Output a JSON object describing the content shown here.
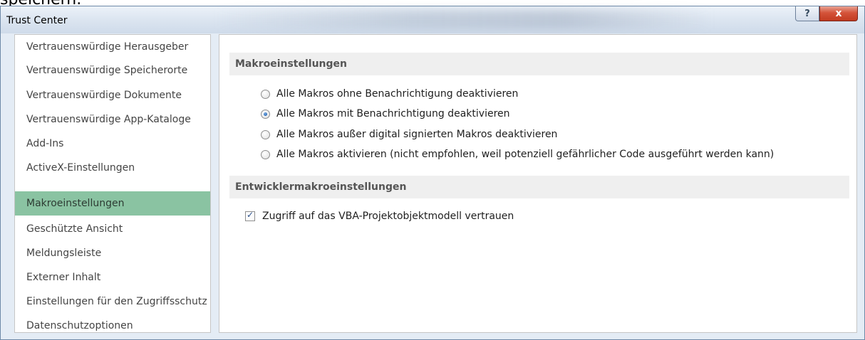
{
  "background_text": "speichern.",
  "window": {
    "title": "Trust Center",
    "help_label": "?",
    "close_label": "x"
  },
  "sidebar": {
    "items": [
      {
        "label": "Vertrauenswürdige Herausgeber",
        "selected": false
      },
      {
        "label": "Vertrauenswürdige Speicherorte",
        "selected": false
      },
      {
        "label": "Vertrauenswürdige Dokumente",
        "selected": false
      },
      {
        "label": "Vertrauenswürdige App-Kataloge",
        "selected": false
      },
      {
        "label": "Add-Ins",
        "selected": false
      },
      {
        "label": "ActiveX-Einstellungen",
        "selected": false
      },
      {
        "label": "Makroeinstellungen",
        "selected": true
      },
      {
        "label": "Geschützte Ansicht",
        "selected": false
      },
      {
        "label": "Meldungsleiste",
        "selected": false
      },
      {
        "label": "Externer Inhalt",
        "selected": false
      },
      {
        "label": "Einstellungen für den Zugriffsschutz",
        "selected": false
      },
      {
        "label": "Datenschutzoptionen",
        "selected": false
      }
    ]
  },
  "main": {
    "macro_section": {
      "title": "Makroeinstellungen",
      "options": [
        {
          "label": "Alle Makros ohne Benachrichtigung deaktivieren",
          "checked": false
        },
        {
          "label": "Alle Makros mit Benachrichtigung deaktivieren",
          "checked": true
        },
        {
          "label": "Alle Makros außer digital signierten Makros deaktivieren",
          "checked": false
        },
        {
          "label": "Alle Makros aktivieren (nicht empfohlen, weil potenziell gefährlicher Code ausgeführt werden kann)",
          "checked": false
        }
      ]
    },
    "developer_section": {
      "title": "Entwicklermakroeinstellungen",
      "vba_access": {
        "label": "Zugriff auf das VBA-Projektobjektmodell vertrauen",
        "checked": true
      }
    }
  }
}
